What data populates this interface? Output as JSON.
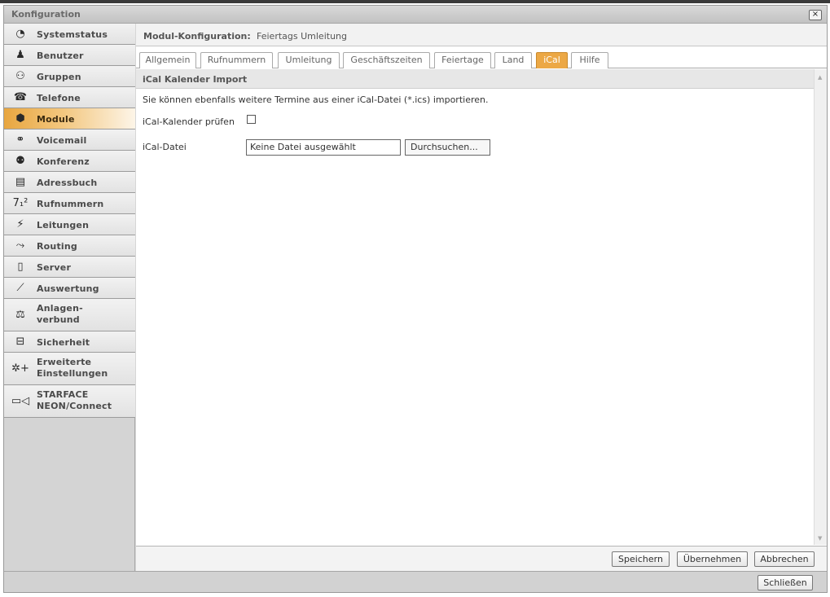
{
  "window": {
    "title": "Konfiguration",
    "close_icon": "close-icon"
  },
  "sidebar": {
    "items": [
      {
        "label": "Systemstatus",
        "icon": "clock-icon",
        "glyph": "◔",
        "active": false
      },
      {
        "label": "Benutzer",
        "icon": "user-icon",
        "glyph": "♟",
        "active": false
      },
      {
        "label": "Gruppen",
        "icon": "group-icon",
        "glyph": "⚇",
        "active": false
      },
      {
        "label": "Telefone",
        "icon": "phone-icon",
        "glyph": "☎",
        "active": false
      },
      {
        "label": "Module",
        "icon": "module-icon",
        "glyph": "⬢",
        "active": true
      },
      {
        "label": "Voicemail",
        "icon": "voicemail-icon",
        "glyph": "⚭",
        "active": false
      },
      {
        "label": "Konferenz",
        "icon": "conference-icon",
        "glyph": "⚉",
        "active": false
      },
      {
        "label": "Adressbuch",
        "icon": "addressbook-icon",
        "glyph": "▤",
        "active": false
      },
      {
        "label": "Rufnummern",
        "icon": "numbers-icon",
        "glyph": "7₁²",
        "active": false
      },
      {
        "label": "Leitungen",
        "icon": "plug-icon",
        "glyph": "⚡",
        "active": false
      },
      {
        "label": "Routing",
        "icon": "routing-icon",
        "glyph": "⤳",
        "active": false
      },
      {
        "label": "Server",
        "icon": "server-icon",
        "glyph": "▯",
        "active": false
      },
      {
        "label": "Auswertung",
        "icon": "chart-icon",
        "glyph": "⟋",
        "active": false
      },
      {
        "label": "Anlagen-\nverbund",
        "icon": "network-icon",
        "glyph": "⚖",
        "active": false,
        "tall": true
      },
      {
        "label": "Sicherheit",
        "icon": "lock-icon",
        "glyph": "⊟",
        "active": false
      },
      {
        "label": "Erweiterte\nEinstellungen",
        "icon": "settings-plus-icon",
        "glyph": "✲+",
        "active": false,
        "tall": true
      },
      {
        "label": "STARFACE\nNEON/Connect",
        "icon": "video-icon",
        "glyph": "▭◁",
        "active": false,
        "tall": true
      }
    ]
  },
  "module_header": {
    "label": "Modul-Konfiguration:",
    "value": "Feiertags Umleitung"
  },
  "tabs": [
    {
      "label": "Allgemein",
      "active": false
    },
    {
      "label": "Rufnummern",
      "active": false
    },
    {
      "label": "Umleitung",
      "active": false
    },
    {
      "label": "Geschäftszeiten",
      "active": false
    },
    {
      "label": "Feiertage",
      "active": false
    },
    {
      "label": "Land",
      "active": false
    },
    {
      "label": "iCal",
      "active": true
    },
    {
      "label": "Hilfe",
      "active": false
    }
  ],
  "section": {
    "title": "iCal Kalender Import"
  },
  "form": {
    "info": "Sie können ebenfalls weitere Termine aus einer iCal-Datei (*.ics) importieren.",
    "check_label": "iCal-Kalender prüfen",
    "check_value": false,
    "file_label": "iCal-Datei",
    "file_value": "Keine Datei ausgewählt",
    "browse_label": "Durchsuchen..."
  },
  "footer": {
    "save": "Speichern",
    "apply": "Übernehmen",
    "cancel": "Abbrechen"
  },
  "bottom": {
    "close": "Schließen"
  },
  "colors": {
    "accent": "#eca845",
    "active_nav": "#e8a640"
  }
}
